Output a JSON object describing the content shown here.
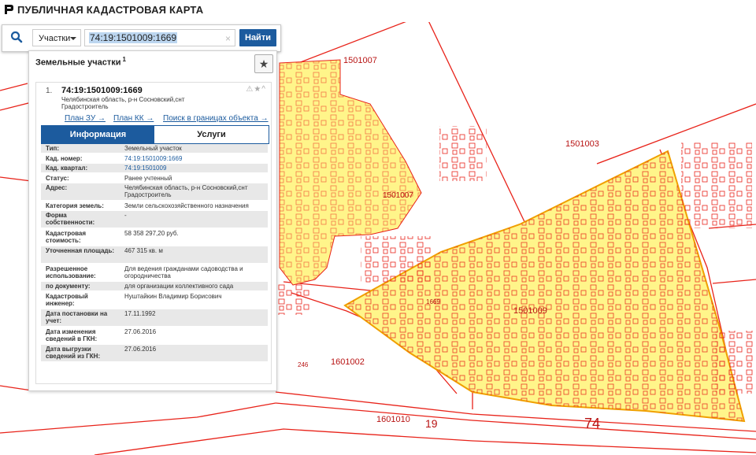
{
  "app": {
    "title": "ПУБЛИЧНАЯ КАДАСТРОВАЯ КАРТА"
  },
  "search": {
    "type_label": "Участки",
    "query": "74:19:1501009:1669",
    "clear_glyph": "×",
    "button_label": "Найти"
  },
  "panel": {
    "title": "Земельные участки",
    "count": "1",
    "fav_glyph": "★"
  },
  "result": {
    "index": "1.",
    "cad_number": "74:19:1501009:1669",
    "address_short": "Челябинская область, р-н Сосновский,снт Градостроитель",
    "tools_glyph": "⚠★^",
    "links": {
      "plan_zu": "План ЗУ →",
      "plan_kk": "План КК →",
      "search_in_bounds": "Поиск в границах объекта →"
    },
    "tabs": {
      "info": "Информация",
      "services": "Услуги"
    },
    "rows": [
      {
        "k": "Тип:",
        "v": "Земельный участок"
      },
      {
        "k": "Кад. номер:",
        "v": "74:19:1501009:1669",
        "link": true
      },
      {
        "k": "Кад. квартал:",
        "v": "74:19:1501009",
        "link": true
      },
      {
        "k": "Статус:",
        "v": "Ранее учтенный"
      },
      {
        "k": "Адрес:",
        "v": "Челябинская область, р-н Сосновский,снт Градостроитель"
      },
      {
        "k": "Категория земель:",
        "v": "Земли сельскохозяйственного назначения"
      },
      {
        "k": "Форма собственности:",
        "v": "-"
      },
      {
        "k": "Кадастровая стоимость:",
        "v": "58 358 297,20 руб."
      },
      {
        "k": "Уточненная площадь:",
        "v": "467 315 кв. м"
      },
      {
        "k": "Разрешенное использование:",
        "v": "Для ведения гражданами садоводства и огородничества"
      },
      {
        "k": "по документу:",
        "v": "для организации коллективного сада"
      },
      {
        "k": "Кадастровый инженер:",
        "v": "Нуштайкин Владимир Борисович"
      },
      {
        "k": "Дата постановки на учет:",
        "v": "17.11.1992"
      },
      {
        "k": "Дата изменения сведений в ГКН:",
        "v": "27.06.2016"
      },
      {
        "k": "Дата выгрузки сведений из ГКН:",
        "v": "27.06.2016"
      }
    ]
  },
  "map": {
    "labels": {
      "q1501007_top": "1501007",
      "q1501007_mid": "1501007",
      "q1501003": "1501003",
      "q1501009": "1501009",
      "parcel_1669": "1669",
      "n246": "246",
      "q1601002": "1601002",
      "q1601010": "1601010",
      "n19": "19",
      "n74": "74"
    },
    "colors": {
      "parcel_fill": "#fff58a",
      "boundary": "#e8231a",
      "selected_boundary": "#f0a000",
      "accent": "#1c5b9e"
    }
  }
}
